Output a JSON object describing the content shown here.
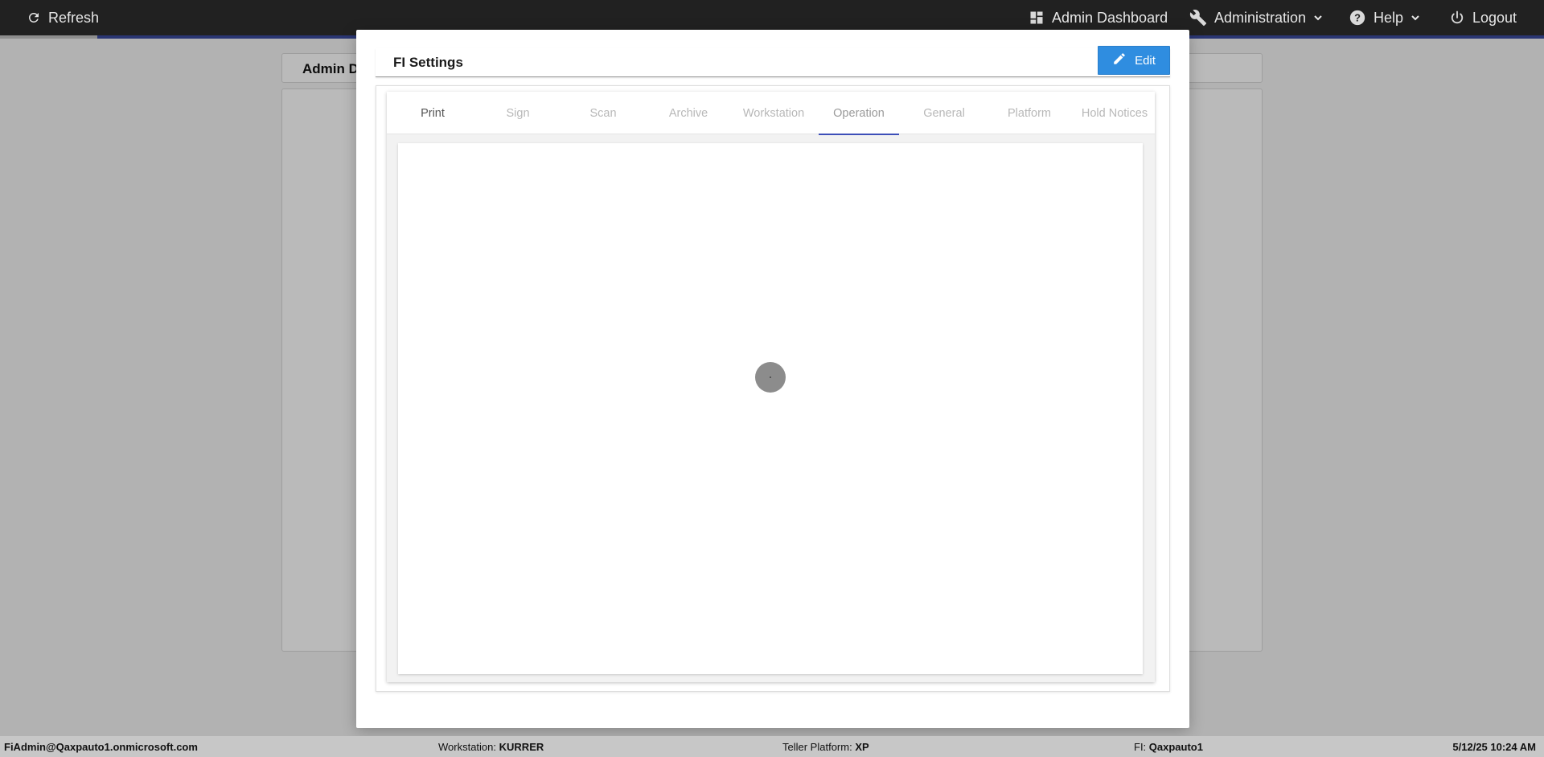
{
  "topbar": {
    "refresh_label": "Refresh",
    "admin_dashboard_label": "Admin Dashboard",
    "administration_label": "Administration",
    "help_label": "Help",
    "logout_label": "Logout"
  },
  "background": {
    "header_title": "Admin D"
  },
  "modal": {
    "title": "FI Settings",
    "edit_label": "Edit",
    "tabs": [
      {
        "label": "Print"
      },
      {
        "label": "Sign"
      },
      {
        "label": "Scan"
      },
      {
        "label": "Archive"
      },
      {
        "label": "Workstation"
      },
      {
        "label": "Operation"
      },
      {
        "label": "General"
      },
      {
        "label": "Platform"
      },
      {
        "label": "Hold Notices"
      }
    ],
    "selected_tab": "Operation"
  },
  "statusbar": {
    "user": "FiAdmin@Qaxpauto1.onmicrosoft.com",
    "workstation_label": "Workstation:",
    "workstation_value": "KURRER",
    "platform_label": "Teller Platform:",
    "platform_value": "XP",
    "fi_label": "FI:",
    "fi_value": "Qaxpauto1",
    "datetime": "5/12/25 10:24 AM"
  },
  "colors": {
    "topbar_bg": "#212121",
    "accent": "#3d4fb8",
    "edit_button": "#2f8de0",
    "statusbar_bg": "#c7c7c7"
  }
}
